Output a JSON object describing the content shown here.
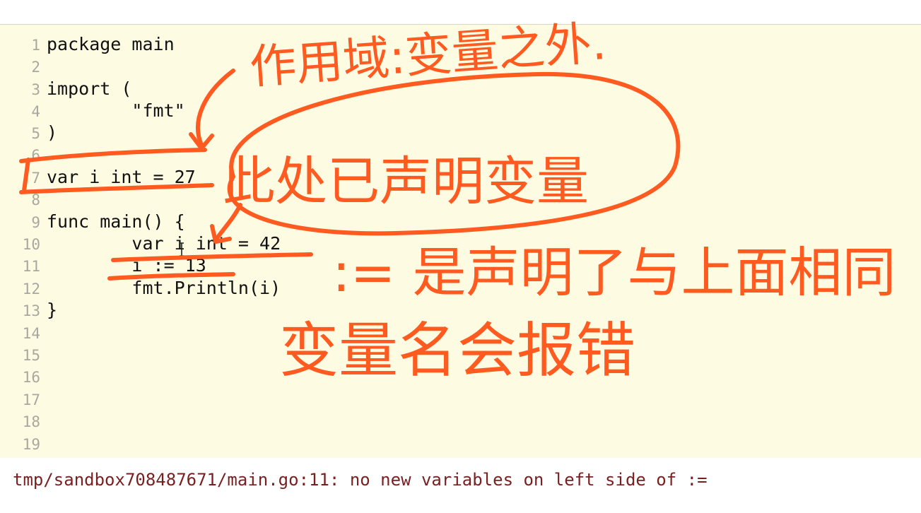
{
  "editor": {
    "lines": [
      {
        "num": "1",
        "text": "package main"
      },
      {
        "num": "2",
        "text": ""
      },
      {
        "num": "3",
        "text": "import ("
      },
      {
        "num": "4",
        "text": "\t\"fmt\""
      },
      {
        "num": "5",
        "text": ")"
      },
      {
        "num": "6",
        "text": ""
      },
      {
        "num": "7",
        "text": "var i int = 27"
      },
      {
        "num": "8",
        "text": ""
      },
      {
        "num": "9",
        "text": "func main() {"
      },
      {
        "num": "10",
        "text": "\tvar i int = 42"
      },
      {
        "num": "11",
        "text": "\ti := 13"
      },
      {
        "num": "12",
        "text": "\tfmt.Println(i)"
      },
      {
        "num": "13",
        "text": "}"
      },
      {
        "num": "14",
        "text": ""
      },
      {
        "num": "15",
        "text": ""
      },
      {
        "num": "16",
        "text": ""
      },
      {
        "num": "17",
        "text": ""
      },
      {
        "num": "18",
        "text": ""
      },
      {
        "num": "19",
        "text": ""
      }
    ]
  },
  "output": {
    "error": "tmp/sandbox708487671/main.go:11: no new variables on left side of :="
  },
  "annotations": {
    "title_note": "作用域:变量之外.",
    "circled_note": "此处已声明变量",
    "explanation_line1": ":= 是声明了与上面相同",
    "explanation_line2": "变量名会报错"
  },
  "colors": {
    "editor_background": "#fdfbe2",
    "annotation_ink": "#ff5a1f",
    "error_text": "#7a1f1f",
    "line_number": "#a8a8a0"
  },
  "icons": {
    "cursor": "text-cursor-icon"
  }
}
